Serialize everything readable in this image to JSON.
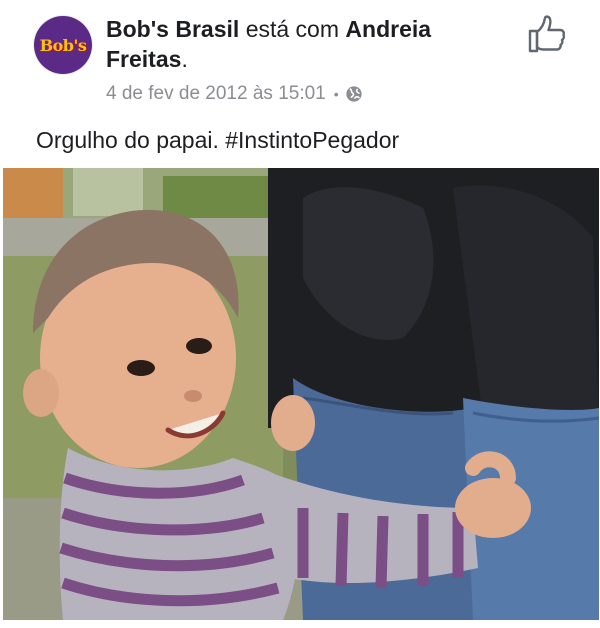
{
  "post": {
    "author": "Bob's Brasil",
    "connector": "está com",
    "tagged_first": "Andreia",
    "tagged_last": "Freitas",
    "tagged_punct": ".",
    "timestamp": "4 de fev de 2012 às 15:01",
    "separator": "•",
    "privacy_icon": "globe-icon",
    "caption": "Orgulho do papai. #InstintoPegador",
    "avatar_text": "Bob's",
    "like_icon": "thumbs-up-icon"
  },
  "colors": {
    "avatar_bg": "#5b2a86",
    "avatar_logo": "#f3c31b",
    "meta_text": "#8a8d91",
    "text": "#1c1e21"
  }
}
